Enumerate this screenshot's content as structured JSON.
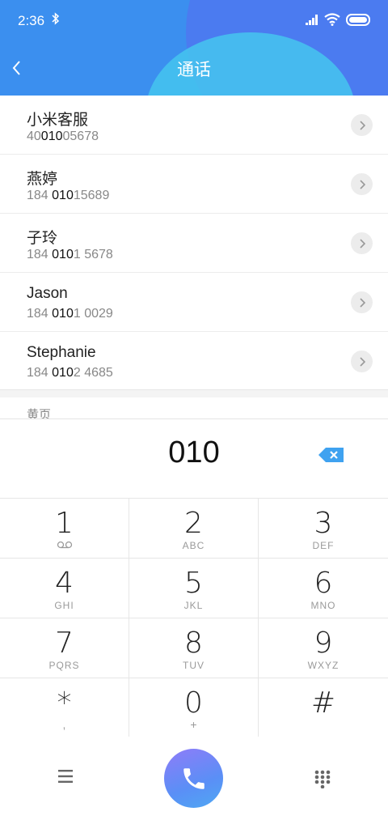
{
  "status_bar": {
    "time": "2:36",
    "bluetooth_icon": "bluetooth-icon",
    "signal_icon": "signal-icon",
    "wifi_icon": "wifi-icon",
    "battery_icon": "battery-icon"
  },
  "header": {
    "title": "通话",
    "back_icon": "chevron-left-icon",
    "colors": {
      "primary": "#3b8fef",
      "accent": "#45c6ee",
      "accent2": "#5a6cf0"
    }
  },
  "contacts": [
    {
      "name": "小米客服",
      "num_pre": "40",
      "num_match": "010",
      "num_post": "05678"
    },
    {
      "name": "燕婷",
      "num_pre": "184 ",
      "num_match": "010",
      "num_post": "15689"
    },
    {
      "name": "子玲",
      "num_pre": "184 ",
      "num_match": "010",
      "num_post": "1 5678"
    },
    {
      "name": "Jason",
      "num_pre": "184 ",
      "num_match": "010",
      "num_post": "1 0029"
    },
    {
      "name": "Stephanie",
      "num_pre": "184 ",
      "num_match": "010",
      "num_post": "2 4685"
    }
  ],
  "section": {
    "label": "黄页"
  },
  "dialer": {
    "value": "010",
    "backspace_icon": "backspace-icon"
  },
  "keys": [
    {
      "digit": "1",
      "sub": "",
      "icon": "voicemail-icon"
    },
    {
      "digit": "2",
      "sub": "ABC"
    },
    {
      "digit": "3",
      "sub": "DEF"
    },
    {
      "digit": "4",
      "sub": "GHI"
    },
    {
      "digit": "5",
      "sub": "JKL"
    },
    {
      "digit": "6",
      "sub": "MNO"
    },
    {
      "digit": "7",
      "sub": "PQRS"
    },
    {
      "digit": "8",
      "sub": "TUV"
    },
    {
      "digit": "9",
      "sub": "WXYZ"
    },
    {
      "digit": "*",
      "sub": ","
    },
    {
      "digit": "0",
      "sub": "+"
    },
    {
      "digit": "#",
      "sub": ""
    }
  ],
  "bottom_bar": {
    "menu_icon": "menu-icon",
    "call_icon": "phone-icon",
    "keypad_icon": "dialpad-icon",
    "call_color": "#6b8cf6"
  }
}
